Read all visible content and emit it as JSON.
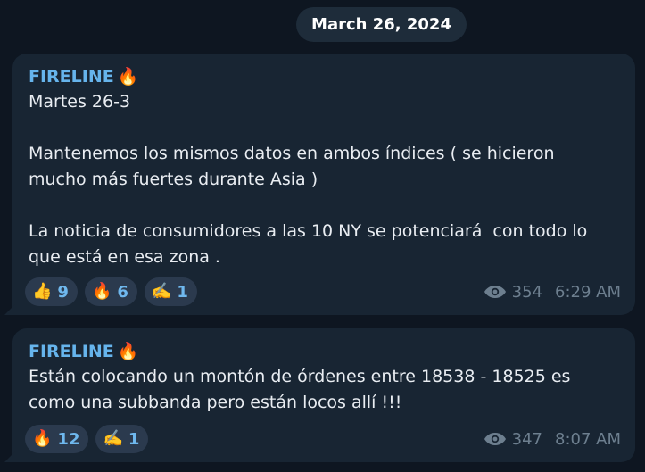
{
  "date_label": "March 26, 2024",
  "messages": [
    {
      "sender": "FIRELINE",
      "sender_icon": "fire-emoji",
      "text": "Martes 26-3\n\nMantenemos los mismos datos en ambos índices ( se hicieron mucho más fuertes durante Asia )\n\nLa noticia de consumidores a las 10 NY se potenciará  con todo lo que está en esa zona .",
      "reactions": [
        {
          "emoji": "👍",
          "count": "9"
        },
        {
          "emoji": "🔥",
          "count": "6"
        },
        {
          "emoji": "✍️",
          "count": "1"
        }
      ],
      "views": "354",
      "time": "6:29 AM"
    },
    {
      "sender": "FIRELINE",
      "sender_icon": "fire-emoji",
      "text": "Están colocando un montón de órdenes entre 18538 - 18525 es como una subbanda pero están locos allí !!!",
      "reactions": [
        {
          "emoji": "🔥",
          "count": "12"
        },
        {
          "emoji": "✍️",
          "count": "1"
        }
      ],
      "views": "347",
      "time": "8:07 AM"
    }
  ],
  "colors": {
    "background": "#0e1621",
    "bubble": "#182533",
    "sender": "#66b4ec",
    "reaction_bg": "#2b3a4e",
    "meta": "#6d7f8f"
  }
}
